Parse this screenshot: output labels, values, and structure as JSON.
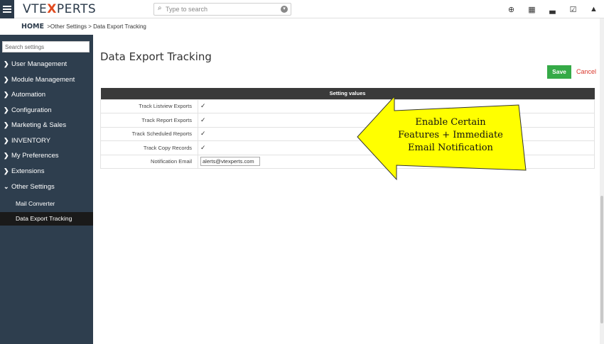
{
  "brand": {
    "logo_prefix": "VTE",
    "logo_x": "X",
    "logo_suffix": "PERTS",
    "accent": "#e04a1f",
    "sidebar_bg": "#2e3e4e",
    "save_color": "#35aa47",
    "cancel_color": "#d9362b"
  },
  "header": {
    "search_placeholder": "Type to search",
    "icons": [
      "add-icon",
      "calendar-icon",
      "chart-icon",
      "tasks-icon",
      "user-icon"
    ]
  },
  "breadcrumb": {
    "home": "HOME",
    "sep1": " >",
    "crumb1": "Other Settings",
    "sep2": " > ",
    "crumb2": "Data Export Tracking"
  },
  "sidebar": {
    "search_placeholder": "Search settings",
    "items": [
      {
        "label": "User Management",
        "expanded": false
      },
      {
        "label": "Module Management",
        "expanded": false
      },
      {
        "label": "Automation",
        "expanded": false
      },
      {
        "label": "Configuration",
        "expanded": false
      },
      {
        "label": "Marketing & Sales",
        "expanded": false
      },
      {
        "label": "INVENTORY",
        "expanded": false
      },
      {
        "label": "My Preferences",
        "expanded": false
      },
      {
        "label": "Extensions",
        "expanded": false
      },
      {
        "label": "Other Settings",
        "expanded": true
      }
    ],
    "subitems": [
      {
        "label": "Mail Converter",
        "active": false
      },
      {
        "label": "Data Export Tracking",
        "active": true
      }
    ]
  },
  "main": {
    "title": "Data Export Tracking",
    "save_label": "Save",
    "cancel_label": "Cancel",
    "table_header": "Setting values",
    "rows": [
      {
        "label": "Track Listview Exports",
        "checked": true
      },
      {
        "label": "Track Report Exports",
        "checked": true
      },
      {
        "label": "Track Scheduled Reports",
        "checked": true
      },
      {
        "label": "Track Copy Records",
        "checked": true
      }
    ],
    "email_label": "Notification Email",
    "email_value": "alerts@vtexperts.com"
  },
  "callout": {
    "line1": "Enable Certain",
    "line2": "Features + Immediate",
    "line3": "Email Notification",
    "fill": "#ffff00"
  }
}
